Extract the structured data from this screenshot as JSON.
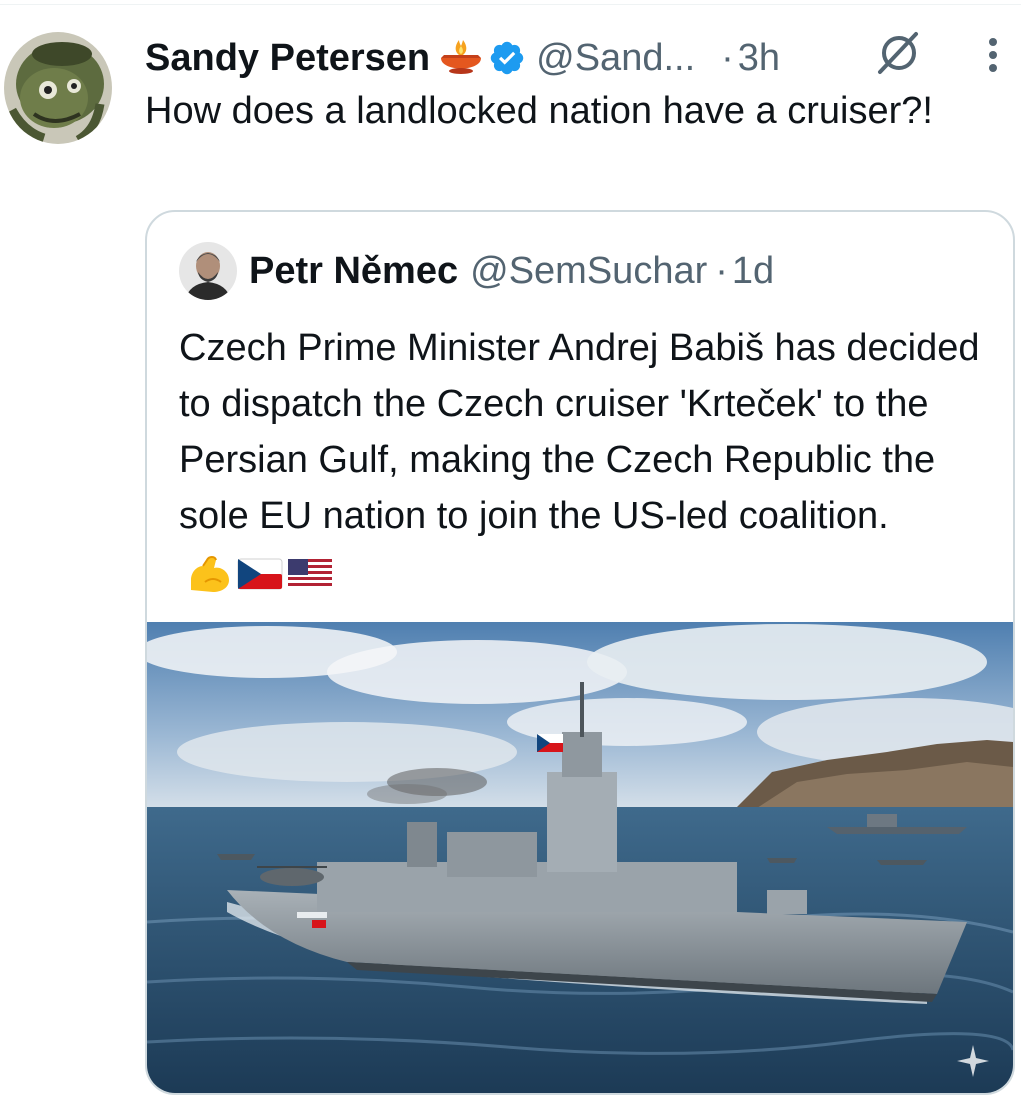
{
  "tweet": {
    "display_name": "Sandy Petersen",
    "handle": "@Sand...",
    "separator": "·",
    "time": "3h",
    "text": "How does a landlocked nation have a cruiser?!",
    "name_emoji_icon": "diya-lamp-icon",
    "verified_color": "#1d9bf0"
  },
  "quote": {
    "display_name": "Petr Němec",
    "handle": "@SemSuchar",
    "separator": "·",
    "time": "1d",
    "text": "Czech Prime Minister Andrej Babiš has decided to dispatch the Czech cruiser 'Krteček' to the Persian Gulf, making the Czech Republic the sole EU nation to join the US-led coalition.",
    "emojis": [
      "flexed-biceps-icon",
      "czech-flag-icon",
      "us-flag-icon"
    ],
    "image_icon": "warship-photo"
  },
  "colors": {
    "text_primary": "#0f1419",
    "text_secondary": "#536471",
    "border": "#cfd9de",
    "accent": "#1d9bf0"
  }
}
